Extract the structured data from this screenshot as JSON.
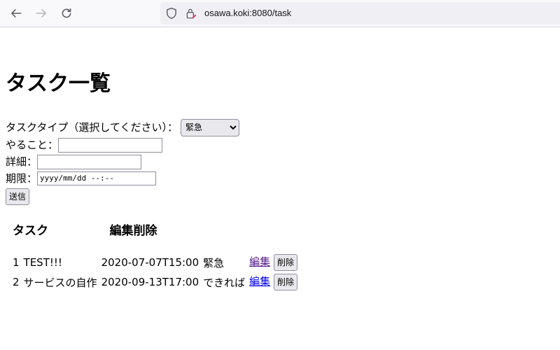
{
  "browser": {
    "url": "osawa.koki:8080/task"
  },
  "page": {
    "title": "タスク一覧",
    "form": {
      "type_label": "タスクタイプ（選択してください）：",
      "type_selected": "緊急",
      "todo_label": "やること：",
      "todo_value": "",
      "detail_label": "詳細：",
      "detail_value": "",
      "deadline_label": "期限：",
      "deadline_placeholder": "yyyy/mm/dd --:--",
      "submit_label": "送信"
    },
    "table": {
      "headers": [
        "タスク",
        "編集",
        "削除"
      ],
      "rows": [
        {
          "id": "1",
          "name": "TEST!!!",
          "deadline": "2020-07-07T15:00",
          "type": "緊急",
          "edit": "編集",
          "delete": "削除"
        },
        {
          "id": "2",
          "name": "サービスの自作",
          "deadline": "2020-09-13T17:00",
          "type": "できれば",
          "edit": "編集",
          "delete": "削除"
        }
      ]
    }
  }
}
